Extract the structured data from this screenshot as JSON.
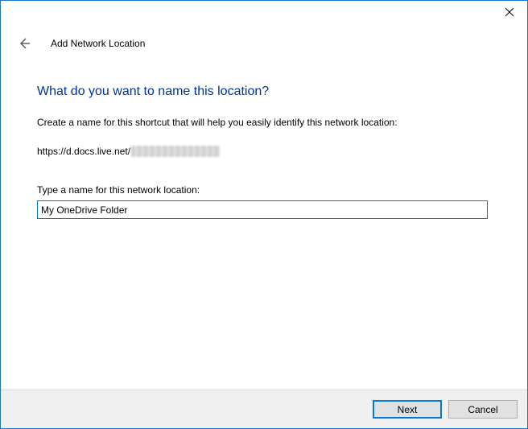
{
  "titlebar": {
    "close_icon": "close"
  },
  "header": {
    "back_icon": "back",
    "title": "Add Network Location"
  },
  "main": {
    "heading": "What do you want to name this location?",
    "description": "Create a name for this shortcut that will help you easily identify this network location:",
    "url_prefix": "https://d.docs.live.net/",
    "input_label": "Type a name for this network location:",
    "input_value": "My OneDrive Folder"
  },
  "footer": {
    "next_label": "Next",
    "cancel_label": "Cancel"
  }
}
